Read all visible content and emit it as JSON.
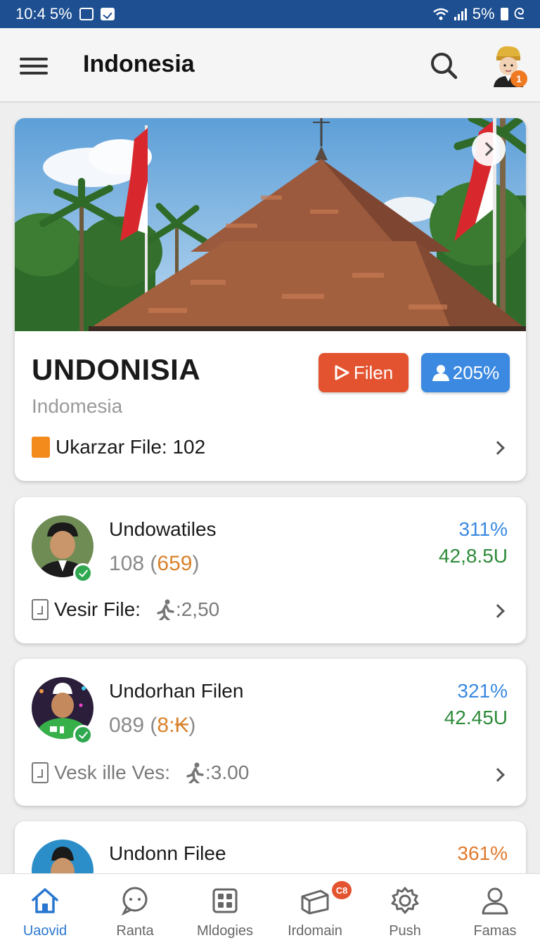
{
  "status_bar": {
    "time": "10:4 5%",
    "battery_text": "5%",
    "extra_text": "ᘓ"
  },
  "app_bar": {
    "title": "Indonesia",
    "notification_count": "1"
  },
  "hero": {
    "title": "UNDONISIA",
    "subtitle": "Indomesia",
    "primary_button": "Filen",
    "secondary_button": "205%",
    "file_label": "Ukarzar File: 102"
  },
  "cards": [
    {
      "name": "Undowatiles",
      "count_main": "108",
      "count_extra": "659",
      "percent": "311%",
      "value": "42,8.5U",
      "file_label": "Vesir File:",
      "file_value": ":2,50"
    },
    {
      "name": "Undorhan Filen",
      "count_main": "089",
      "count_extra": "8:₭",
      "percent": "321%",
      "value": "42.45U",
      "file_label": "Vesk ille Ves:",
      "file_value": ":3.00"
    },
    {
      "name": "Undonn Filee",
      "percent": "361%",
      "percent_color": "#e07a2e"
    }
  ],
  "bottom_nav": [
    {
      "label": "Uaovid",
      "icon": "home-icon",
      "active": true
    },
    {
      "label": "Ranta",
      "icon": "chat-icon"
    },
    {
      "label": "Mldogies",
      "icon": "grid-icon"
    },
    {
      "label": "Irdomain",
      "icon": "folder-icon",
      "badge": "C8"
    },
    {
      "label": "Push",
      "icon": "gear-icon"
    },
    {
      "label": "Famas",
      "icon": "person-icon"
    }
  ],
  "colors": {
    "status_bar": "#1d4f91",
    "accent_blue": "#3b89e0",
    "accent_red": "#e4532f",
    "value_green": "#2e8b3a",
    "highlight_orange": "#d9822b"
  }
}
